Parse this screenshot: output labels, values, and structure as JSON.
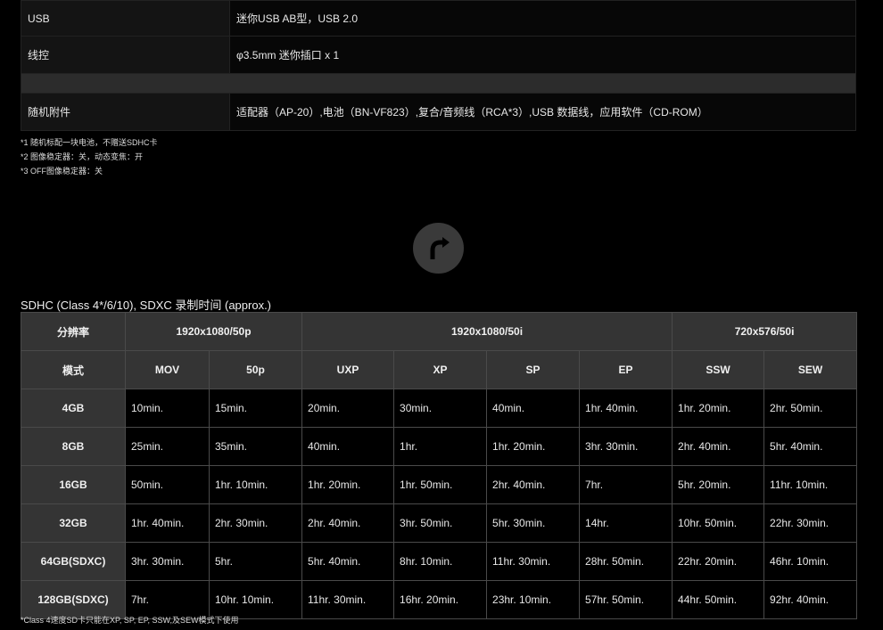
{
  "specs": {
    "rows": [
      {
        "label": "USB",
        "value": "迷你USB AB型，USB 2.0"
      },
      {
        "label": "线控",
        "value": "φ3.5mm 迷你插口 x 1"
      },
      {
        "label": "随机附件",
        "value": "适配器（AP-20）,电池（BN-VF823）,复合/音频线（RCA*3）,USB 数据线，应用软件（CD-ROM）"
      }
    ]
  },
  "notes": [
    "*1 随机标配一块电池，不赠送SDHC卡",
    "*2 图像稳定器：关，动态变焦：开",
    "*3 OFF图像稳定器：关"
  ],
  "back_to_top": {
    "icon": "back-to-top-arrow-icon"
  },
  "recording": {
    "title": "SDHC (Class 4*/6/10), SDXC 录制时间 (approx.)",
    "header1": {
      "resolution_label": "分辨率",
      "groups": [
        "1920x1080/50p",
        "1920x1080/50i",
        "720x576/50i"
      ]
    },
    "header2": {
      "mode_label": "模式",
      "modes": [
        "MOV",
        "50p",
        "UXP",
        "XP",
        "SP",
        "EP",
        "SSW",
        "SEW"
      ]
    },
    "rows": [
      {
        "capacity": "4GB",
        "values": [
          "10min.",
          "15min.",
          "20min.",
          "30min.",
          "40min.",
          "1hr. 40min.",
          "1hr. 20min.",
          "2hr. 50min."
        ]
      },
      {
        "capacity": "8GB",
        "values": [
          "25min.",
          "35min.",
          "40min.",
          "1hr.",
          "1hr. 20min.",
          "3hr. 30min.",
          "2hr. 40min.",
          "5hr. 40min."
        ]
      },
      {
        "capacity": "16GB",
        "values": [
          "50min.",
          "1hr. 10min.",
          "1hr. 20min.",
          "1hr. 50min.",
          "2hr. 40min.",
          "7hr.",
          "5hr. 20min.",
          "11hr. 10min."
        ]
      },
      {
        "capacity": "32GB",
        "values": [
          "1hr. 40min.",
          "2hr. 30min.",
          "2hr. 40min.",
          "3hr. 50min.",
          "5hr. 30min.",
          "14hr.",
          "10hr. 50min.",
          "22hr. 30min."
        ]
      },
      {
        "capacity": "64GB(SDXC)",
        "values": [
          "3hr. 30min.",
          "5hr.",
          "5hr. 40min.",
          "8hr. 10min.",
          "11hr. 30min.",
          "28hr. 50min.",
          "22hr. 20min.",
          "46hr. 10min."
        ]
      },
      {
        "capacity": "128GB(SDXC)",
        "values": [
          "7hr.",
          "10hr. 10min.",
          "11hr. 30min.",
          "16hr. 20min.",
          "23hr. 10min.",
          "57hr. 50min.",
          "44hr. 50min.",
          "92hr. 40min."
        ]
      }
    ],
    "footnote": "*Class 4速度SD卡只能在XP, SP, EP, SSW,及SEW模式下使用"
  }
}
